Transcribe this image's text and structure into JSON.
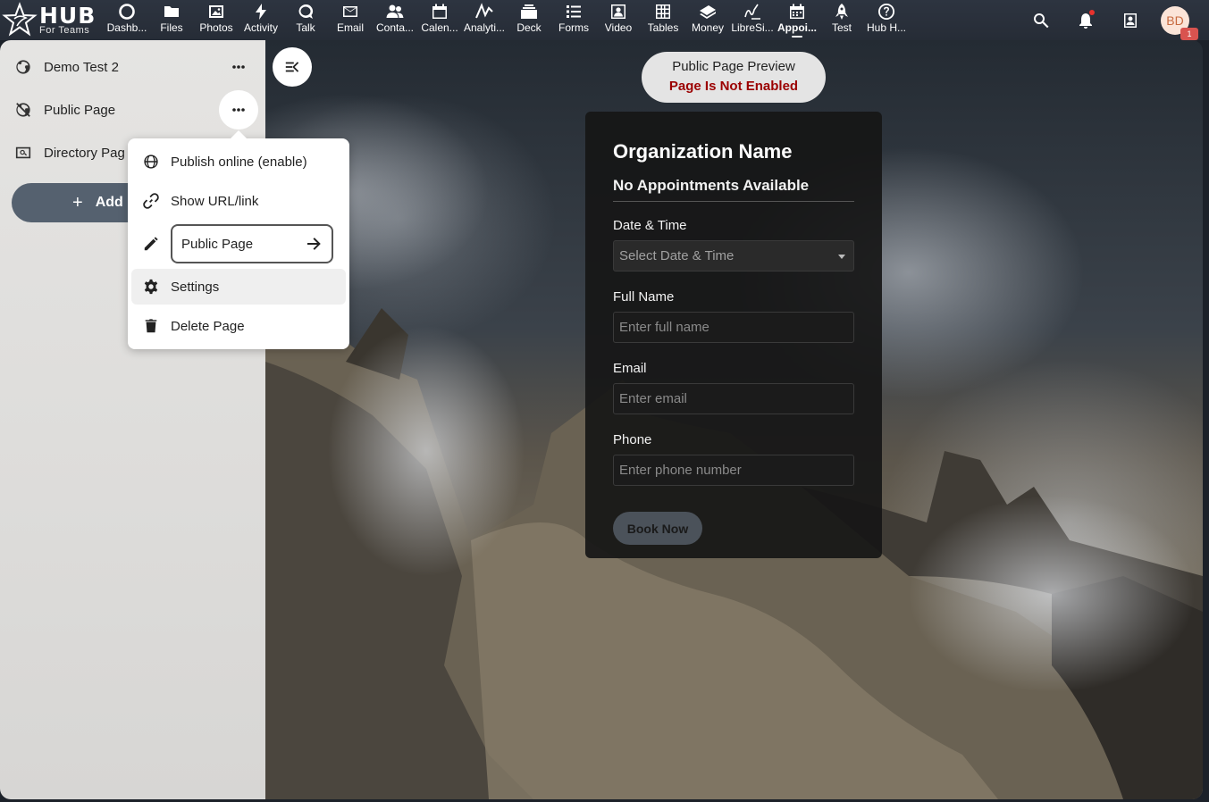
{
  "logo": {
    "brand": "HUB",
    "tagline": "For Teams"
  },
  "apps": [
    {
      "id": "dashboard",
      "label": "Dashb...",
      "icon": "dashboard-icon"
    },
    {
      "id": "files",
      "label": "Files",
      "icon": "folder-icon"
    },
    {
      "id": "photos",
      "label": "Photos",
      "icon": "image-icon"
    },
    {
      "id": "activity",
      "label": "Activity",
      "icon": "lightning-icon"
    },
    {
      "id": "talk",
      "label": "Talk",
      "icon": "chat-icon"
    },
    {
      "id": "email",
      "label": "Email",
      "icon": "mail-icon"
    },
    {
      "id": "contacts",
      "label": "Conta...",
      "icon": "contacts-icon"
    },
    {
      "id": "calendar",
      "label": "Calen...",
      "icon": "calendar-icon"
    },
    {
      "id": "analytics",
      "label": "Analyti...",
      "icon": "analytics-icon"
    },
    {
      "id": "deck",
      "label": "Deck",
      "icon": "deck-icon"
    },
    {
      "id": "forms",
      "label": "Forms",
      "icon": "list-icon"
    },
    {
      "id": "video",
      "label": "Video",
      "icon": "video-icon"
    },
    {
      "id": "tables",
      "label": "Tables",
      "icon": "table-icon"
    },
    {
      "id": "money",
      "label": "Money",
      "icon": "money-icon"
    },
    {
      "id": "libresign",
      "label": "LibreSi...",
      "icon": "signature-icon"
    },
    {
      "id": "appointments",
      "label": "Appoi...",
      "icon": "appointment-calendar-icon",
      "active": true
    },
    {
      "id": "test",
      "label": "Test",
      "icon": "rocket-icon"
    },
    {
      "id": "hubhelp",
      "label": "Hub H...",
      "icon": "help-icon"
    }
  ],
  "header": {
    "avatar_initials": "BD",
    "avatar_badge": "1"
  },
  "sidebar": {
    "items": [
      {
        "label": "Demo Test 2",
        "icon": "globe-icon"
      },
      {
        "label": "Public Page",
        "icon": "globe-off-icon"
      },
      {
        "label": "Directory Pag",
        "icon": "directory-search-icon"
      }
    ],
    "add_label": "Add",
    "add_symbol": "+"
  },
  "menu": {
    "publish": "Publish online (enable)",
    "show_url": "Show URL/link",
    "rename_value": "Public Page",
    "settings": "Settings",
    "delete": "Delete Page"
  },
  "preview": {
    "title": "Public Page Preview",
    "status": "Page Is Not Enabled",
    "status_color": "#9b0000"
  },
  "form": {
    "org_name": "Organization Name",
    "no_appointments": "No Appointments Available",
    "date_label": "Date & Time",
    "date_placeholder": "Select Date & Time",
    "name_label": "Full Name",
    "name_placeholder": "Enter full name",
    "email_label": "Email",
    "email_placeholder": "Enter email",
    "phone_label": "Phone",
    "phone_placeholder": "Enter phone number",
    "submit": "Book Now"
  }
}
